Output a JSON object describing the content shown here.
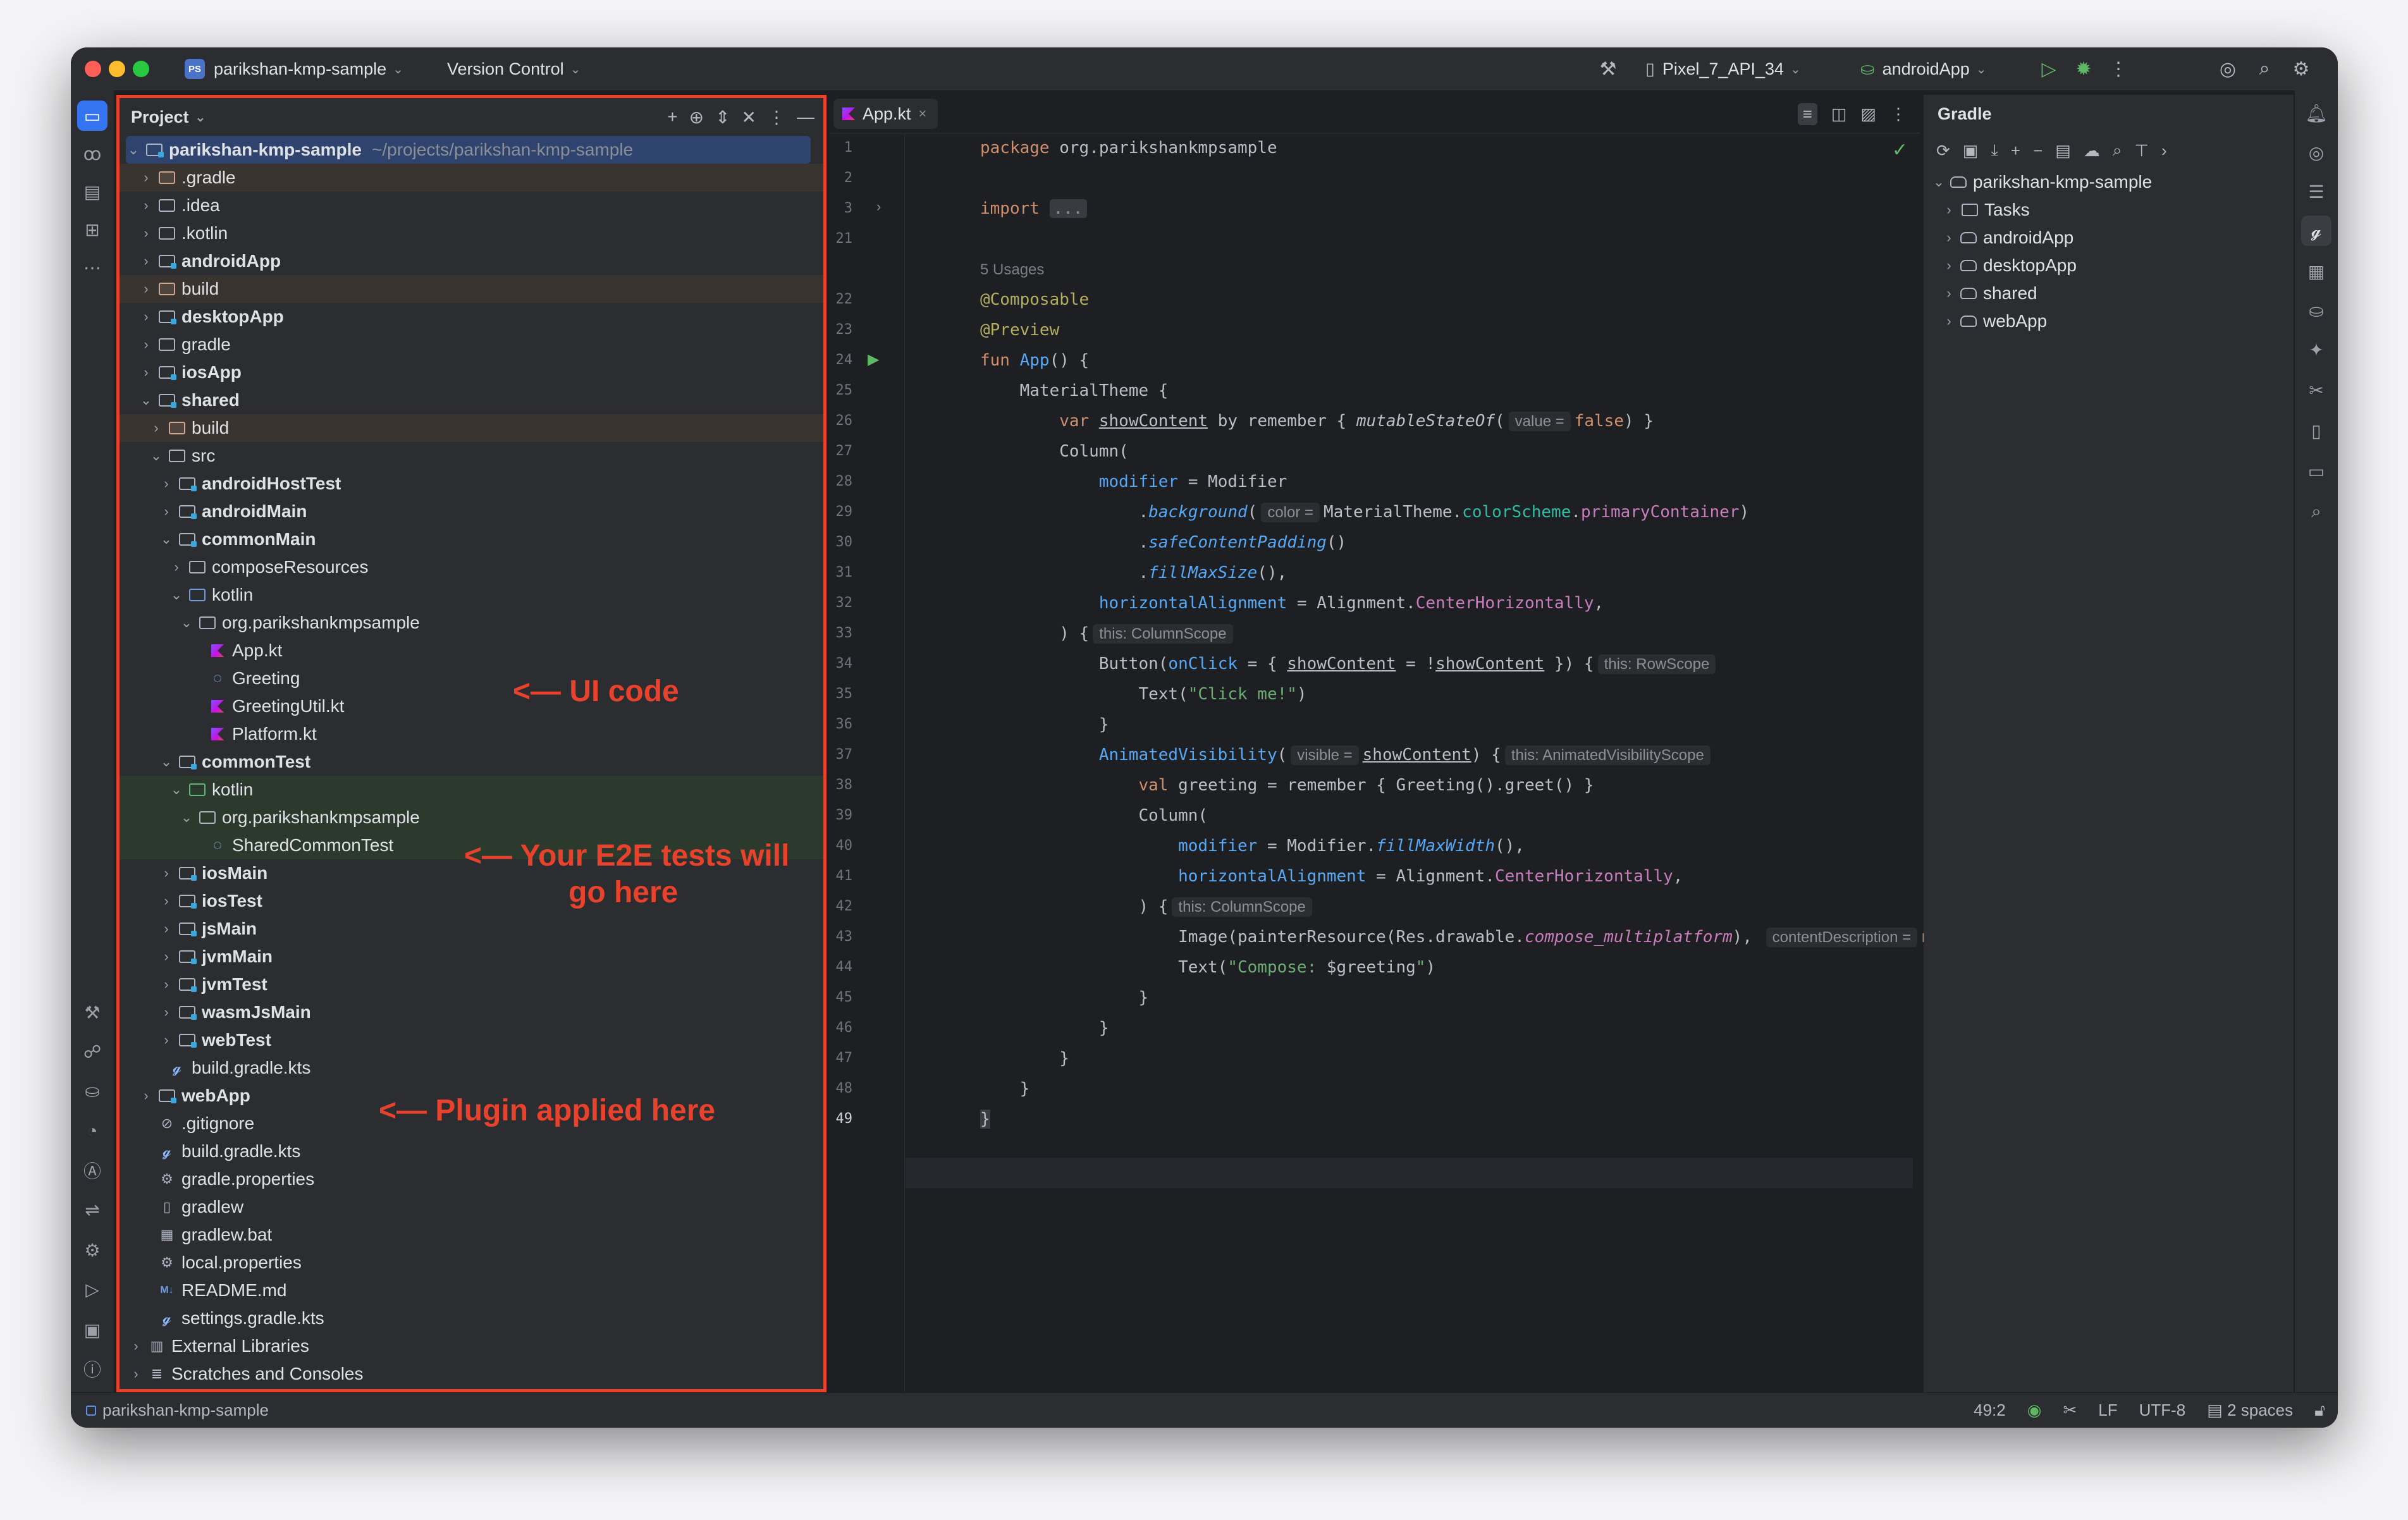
{
  "titlebar": {
    "project_badge": "PS",
    "project_name": "parikshan-kmp-sample",
    "vcs": "Version Control",
    "device": "Pixel_7_API_34",
    "run_config": "androidApp"
  },
  "project_panel": {
    "title": "Project",
    "root_name": "parikshan-kmp-sample",
    "root_path": "~/projects/parikshan-kmp-sample",
    "tree": [
      {
        "label": ".gradle"
      },
      {
        "label": ".idea"
      },
      {
        "label": ".kotlin"
      },
      {
        "label": "androidApp"
      },
      {
        "label": "build"
      },
      {
        "label": "desktopApp"
      },
      {
        "label": "gradle"
      },
      {
        "label": "iosApp"
      },
      {
        "label": "shared"
      },
      {
        "label": "build"
      },
      {
        "label": "src"
      },
      {
        "label": "androidHostTest"
      },
      {
        "label": "androidMain"
      },
      {
        "label": "commonMain"
      },
      {
        "label": "composeResources"
      },
      {
        "label": "kotlin"
      },
      {
        "label": "org.parikshankmpsample"
      },
      {
        "label": "App.kt"
      },
      {
        "label": "Greeting"
      },
      {
        "label": "GreetingUtil.kt"
      },
      {
        "label": "Platform.kt"
      },
      {
        "label": "commonTest"
      },
      {
        "label": "kotlin"
      },
      {
        "label": "org.parikshankmpsample"
      },
      {
        "label": "SharedCommonTest"
      },
      {
        "label": "iosMain"
      },
      {
        "label": "iosTest"
      },
      {
        "label": "jsMain"
      },
      {
        "label": "jvmMain"
      },
      {
        "label": "jvmTest"
      },
      {
        "label": "wasmJsMain"
      },
      {
        "label": "webTest"
      },
      {
        "label": "build.gradle.kts"
      },
      {
        "label": "webApp"
      },
      {
        "label": ".gitignore"
      },
      {
        "label": "build.gradle.kts"
      },
      {
        "label": "gradle.properties"
      },
      {
        "label": "gradlew"
      },
      {
        "label": "gradlew.bat"
      },
      {
        "label": "local.properties"
      },
      {
        "label": "README.md"
      },
      {
        "label": "settings.gradle.kts"
      },
      {
        "label": "External Libraries"
      },
      {
        "label": "Scratches and Consoles"
      }
    ]
  },
  "annotations": {
    "ui_code": "<— UI code",
    "e2e_line1": "<— Your E2E tests will",
    "e2e_line2": "go here",
    "plugin": "<— Plugin applied here"
  },
  "editor": {
    "tab_label": "App.kt",
    "line_numbers": [
      "1",
      "2",
      "3",
      "21",
      "",
      "22",
      "23",
      "24",
      "25",
      "26",
      "27",
      "28",
      "29",
      "30",
      "31",
      "32",
      "33",
      "34",
      "35",
      "36",
      "37",
      "38",
      "39",
      "40",
      "41",
      "42",
      "43",
      "44",
      "45",
      "46",
      "47",
      "48",
      "49"
    ],
    "usages": "5 Usages",
    "hints": {
      "value": "value =",
      "color": "color =",
      "column_scope": "this: ColumnScope",
      "row_scope": "this: RowScope",
      "visible": "visible =",
      "anim_scope": "this: AnimatedVisibilityScope",
      "column_scope2": "this: ColumnScope",
      "content_desc": "contentDescription ="
    },
    "code": {
      "l1_kw": "package",
      "l1_rest": " org.parikshankmpsample",
      "l3_kw": "import",
      "l3_fold": "...",
      "l22": "@Composable",
      "l23": "@Preview",
      "l24_kw": "fun",
      "l24_fn": "App",
      "l24_rest": "() {",
      "l25": "    MaterialTheme {",
      "l26_a": "        ",
      "l26_kw": "var",
      "l26_b": " ",
      "l26_var": "showContent",
      "l26_c": " by remember { ",
      "l26_fn": "mutableStateOf",
      "l26_d": "(",
      "l26_val": "false",
      "l26_e": ") }",
      "l27": "        Column(",
      "l28_a": "            ",
      "l28_p": "modifier",
      "l28_b": " = Modifier",
      "l29_a": "                .",
      "l29_fn": "background",
      "l29_b": "(",
      "l29_c": "MaterialTheme.",
      "l29_p1": "colorScheme",
      "l29_d": ".",
      "l29_p2": "primaryContainer",
      "l29_e": ")",
      "l30_a": "                .",
      "l30_fn": "safeContentPadding",
      "l30_b": "()",
      "l31_a": "                .",
      "l31_fn": "fillMaxSize",
      "l31_b": "(),",
      "l32_a": "            ",
      "l32_p": "horizontalAlignment",
      "l32_b": " = Alignment.",
      "l32_c": "CenterHorizontally",
      "l32_d": ",",
      "l33": "        ) {",
      "l34_a": "            Button(",
      "l34_p": "onClick",
      "l34_b": " = { ",
      "l34_v1": "showContent",
      "l34_c": " = !",
      "l34_v2": "showContent",
      "l34_d": " }) {",
      "l35_a": "                Text(",
      "l35_s": "\"Click me!\"",
      "l35_b": ")",
      "l36": "            }",
      "l37_a": "            ",
      "l37_fn": "AnimatedVisibility",
      "l37_b": "(",
      "l37_v": "showContent",
      "l37_c": ") {",
      "l38_a": "                ",
      "l38_kw": "val",
      "l38_b": " greeting = remember { Greeting().greet() }",
      "l39": "                Column(",
      "l40_a": "                    ",
      "l40_p": "modifier",
      "l40_b": " = Modifier.",
      "l40_fn": "fillMaxWidth",
      "l40_c": "(),",
      "l41_a": "                    ",
      "l41_p": "horizontalAlignment",
      "l41_b": " = Alignment.",
      "l41_c": "CenterHorizontally",
      "l41_d": ",",
      "l42": "                ) {",
      "l43_a": "                    Image(painterResource(Res.drawable.",
      "l43_p": "compose_multiplatform",
      "l43_b": "), ",
      "l43_kw": "null",
      "l43_c": ")",
      "l44_a": "                    Text(",
      "l44_s": "\"Compose: ",
      "l44_t": "$greeting",
      "l44_s2": "\"",
      "l44_b": ")",
      "l45": "                }",
      "l46": "            }",
      "l47": "        }",
      "l48": "    }",
      "l49": "}"
    }
  },
  "gradle_panel": {
    "title": "Gradle",
    "root": "parikshan-kmp-sample",
    "items": [
      "Tasks",
      "androidApp",
      "desktopApp",
      "shared",
      "webApp"
    ]
  },
  "statusbar": {
    "breadcrumb": "parikshan-kmp-sample",
    "position": "49:2",
    "line_sep": "LF",
    "encoding": "UTF-8",
    "indent": "2 spaces"
  },
  "colors": {
    "accent": "#3574f0",
    "annotation": "#e8412c",
    "background": "#1e1f22",
    "panel": "#2b2d30"
  }
}
